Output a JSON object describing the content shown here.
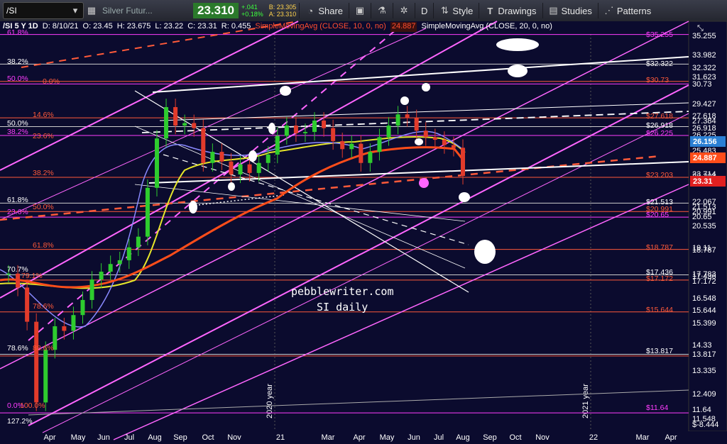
{
  "toolbar": {
    "symbol": "/SI",
    "description": "Silver Futur...",
    "last_price": "23.310",
    "change": "+.041",
    "change_pct": "+0.18%",
    "bid": "B: 23.305",
    "ask": "A: 23.310",
    "share_label": "Share",
    "period_label": "D",
    "style_label": "Style",
    "drawings_label": "Drawings",
    "studies_label": "Studies",
    "patterns_label": "Patterns"
  },
  "legend": {
    "header": "/SI 5 Y 1D",
    "date": "D: 8/10/21",
    "open": "O: 23.45",
    "high": "H: 23.675",
    "low": "L: 23.22",
    "close": "C: 23.31",
    "range": "R: 0.455",
    "sma10_label": "SimpleMovingAvg (CLOSE, 10, 0, no)",
    "sma10_value": "24.887",
    "sma20_label": "SimpleMovingAvg (CLOSE, 20, 0, no)"
  },
  "watermark": {
    "line1": "pebblewriter.com",
    "line2": "SI daily"
  },
  "colors": {
    "background": "#0b0b2e",
    "fib_magenta": "#ff3dff",
    "fib_red": "#ff5a3a",
    "sma10": "#ff4d1a",
    "sma20": "#ffffff",
    "sma_yellow": "#e6e62a",
    "sma_blue": "#8a8aff",
    "channel_pink": "#ff66ff",
    "candle_up": "#2ecc2e",
    "candle_down": "#e23b2b"
  },
  "chart_data": {
    "type": "candlestick",
    "symbol": "/SI",
    "yaxis_ticks": [
      "35.255",
      "33.982",
      "32.322",
      "31.623",
      "30.73",
      "29.427",
      "27.618",
      "27.384",
      "26.918",
      "26.225",
      "26.156",
      "25.483",
      "24.887",
      "23.714",
      "23.203",
      "23.31",
      "22.067",
      "21.513",
      "20.991",
      "20.65",
      "20.535",
      "19.11",
      "18.787",
      "17.783",
      "17.436",
      "17.172",
      "16.548",
      "15.644",
      "15.399",
      "14.33",
      "13.817",
      "13.335",
      "12.409",
      "11.64",
      "11.548",
      "$-8.444"
    ],
    "xaxis_ticks": [
      "Apr",
      "May",
      "Jun",
      "Jul",
      "Aug",
      "Sep",
      "Oct",
      "Nov",
      "21",
      "Mar",
      "Apr",
      "May",
      "Jun",
      "Jul",
      "Aug",
      "Sep",
      "Oct",
      "Nov",
      "22",
      "Mar",
      "Apr"
    ],
    "year_markers": [
      "2020 year",
      "2021 year"
    ],
    "badges": [
      {
        "label": "26.156",
        "color": "#2a7fd4"
      },
      {
        "label": "24.887",
        "color": "#ff4d1a"
      },
      {
        "label": "23.31",
        "color": "#e02020"
      }
    ],
    "fib_levels_left": [
      {
        "label": "61.8%",
        "color": "#ff3dff"
      },
      {
        "label": "38.2%",
        "color": "#ffffff"
      },
      {
        "label": "50.0%",
        "color": "#ff3dff"
      },
      {
        "label": "0.0%",
        "color": "#ff5a3a"
      },
      {
        "label": "14.6%",
        "color": "#ff5a3a"
      },
      {
        "label": "50.0%",
        "color": "#ffffff"
      },
      {
        "label": "38.2%",
        "color": "#ff3dff"
      },
      {
        "label": "23.6%",
        "color": "#ff5a3a"
      },
      {
        "label": "38.2%",
        "color": "#ff5a3a"
      },
      {
        "label": "61.8%",
        "color": "#ffffff"
      },
      {
        "label": "50.0%",
        "color": "#ff5a3a"
      },
      {
        "label": "23.6%",
        "color": "#ff3dff"
      },
      {
        "label": "61.8%",
        "color": "#ff5a3a"
      },
      {
        "label": "70.7%",
        "color": "#ffffff"
      },
      {
        "label": "79.1%",
        "color": "#ff5a3a"
      },
      {
        "label": "78.6%",
        "color": "#ff5a3a"
      },
      {
        "label": "78.6%",
        "color": "#ffffff"
      },
      {
        "label": "88.6%",
        "color": "#ff5a3a"
      },
      {
        "label": "0.0%",
        "color": "#ff3dff"
      },
      {
        "label": "100.0%",
        "color": "#ff5a3a"
      },
      {
        "label": "127.2%",
        "color": "#ffffff"
      }
    ],
    "fib_levels_right": [
      {
        "label": "$35.255",
        "color": "#ff3dff"
      },
      {
        "label": "$32.322",
        "color": "#ffffff"
      },
      {
        "label": "$30.73",
        "color": "#ff5a3a"
      },
      {
        "label": "$27.618",
        "color": "#ff5a3a"
      },
      {
        "label": "$26.918",
        "color": "#ffffff"
      },
      {
        "label": "$26.225",
        "color": "#ff3dff"
      },
      {
        "label": "$23.203",
        "color": "#ff5a3a"
      },
      {
        "label": "$21.513",
        "color": "#ffffff"
      },
      {
        "label": "$20.991",
        "color": "#ff5a3a"
      },
      {
        "label": "$20.65",
        "color": "#ff3dff"
      },
      {
        "label": "$18.787",
        "color": "#ff5a3a"
      },
      {
        "label": "$17.436",
        "color": "#ffffff"
      },
      {
        "label": "$17.172",
        "color": "#ff5a3a"
      },
      {
        "label": "$15.644",
        "color": "#ff5a3a"
      },
      {
        "label": "$13.817",
        "color": "#ffffff"
      },
      {
        "label": "$11.64",
        "color": "#ff3dff"
      }
    ],
    "close_series_approx": [
      17.5,
      16.8,
      15.2,
      12.0,
      14.0,
      15.0,
      14.8,
      15.5,
      16.2,
      17.2,
      17.6,
      18.0,
      18.2,
      18.9,
      19.5,
      22.5,
      26.0,
      28.5,
      27.0,
      27.2,
      26.8,
      24.2,
      25.0,
      24.3,
      23.4,
      24.1,
      23.5,
      24.2,
      24.8,
      26.2,
      27.0,
      26.4,
      26.5,
      27.4,
      26.8,
      25.8,
      25.2,
      25.6,
      24.2,
      25.0,
      26.1,
      27.0,
      27.9,
      27.6,
      26.6,
      26.1,
      25.9,
      25.5,
      25.3,
      23.3
    ],
    "last_close": 23.31,
    "grid": false
  }
}
